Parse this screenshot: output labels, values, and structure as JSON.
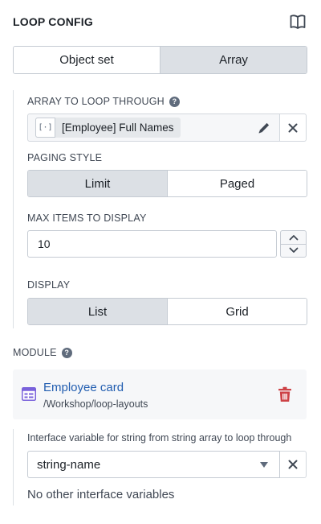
{
  "header": {
    "title": "LOOP CONFIG",
    "icon": "book-icon"
  },
  "source_toggle": {
    "options": [
      "Object set",
      "Array"
    ],
    "selected": "Array"
  },
  "array_section": {
    "label": "ARRAY TO LOOP THROUGH",
    "value_tag": "[Employee] Full Names",
    "tag_icon_glyph": "[·]"
  },
  "paging": {
    "label": "PAGING STYLE",
    "options": [
      "Limit",
      "Paged"
    ],
    "selected": "Limit"
  },
  "max_items": {
    "label": "MAX ITEMS TO DISPLAY",
    "value": "10"
  },
  "display": {
    "label": "DISPLAY",
    "options": [
      "List",
      "Grid"
    ],
    "selected": "List"
  },
  "module": {
    "label": "MODULE",
    "name": "Employee card",
    "path": "/Workshop/loop-layouts"
  },
  "interface": {
    "label": "Interface variable for string from string array to loop through",
    "selected": "string-name",
    "empty_text": "No other interface variables"
  },
  "colors": {
    "accent_text": "#215db0",
    "danger": "#cd4246",
    "active_segment": "#dce0e5"
  }
}
